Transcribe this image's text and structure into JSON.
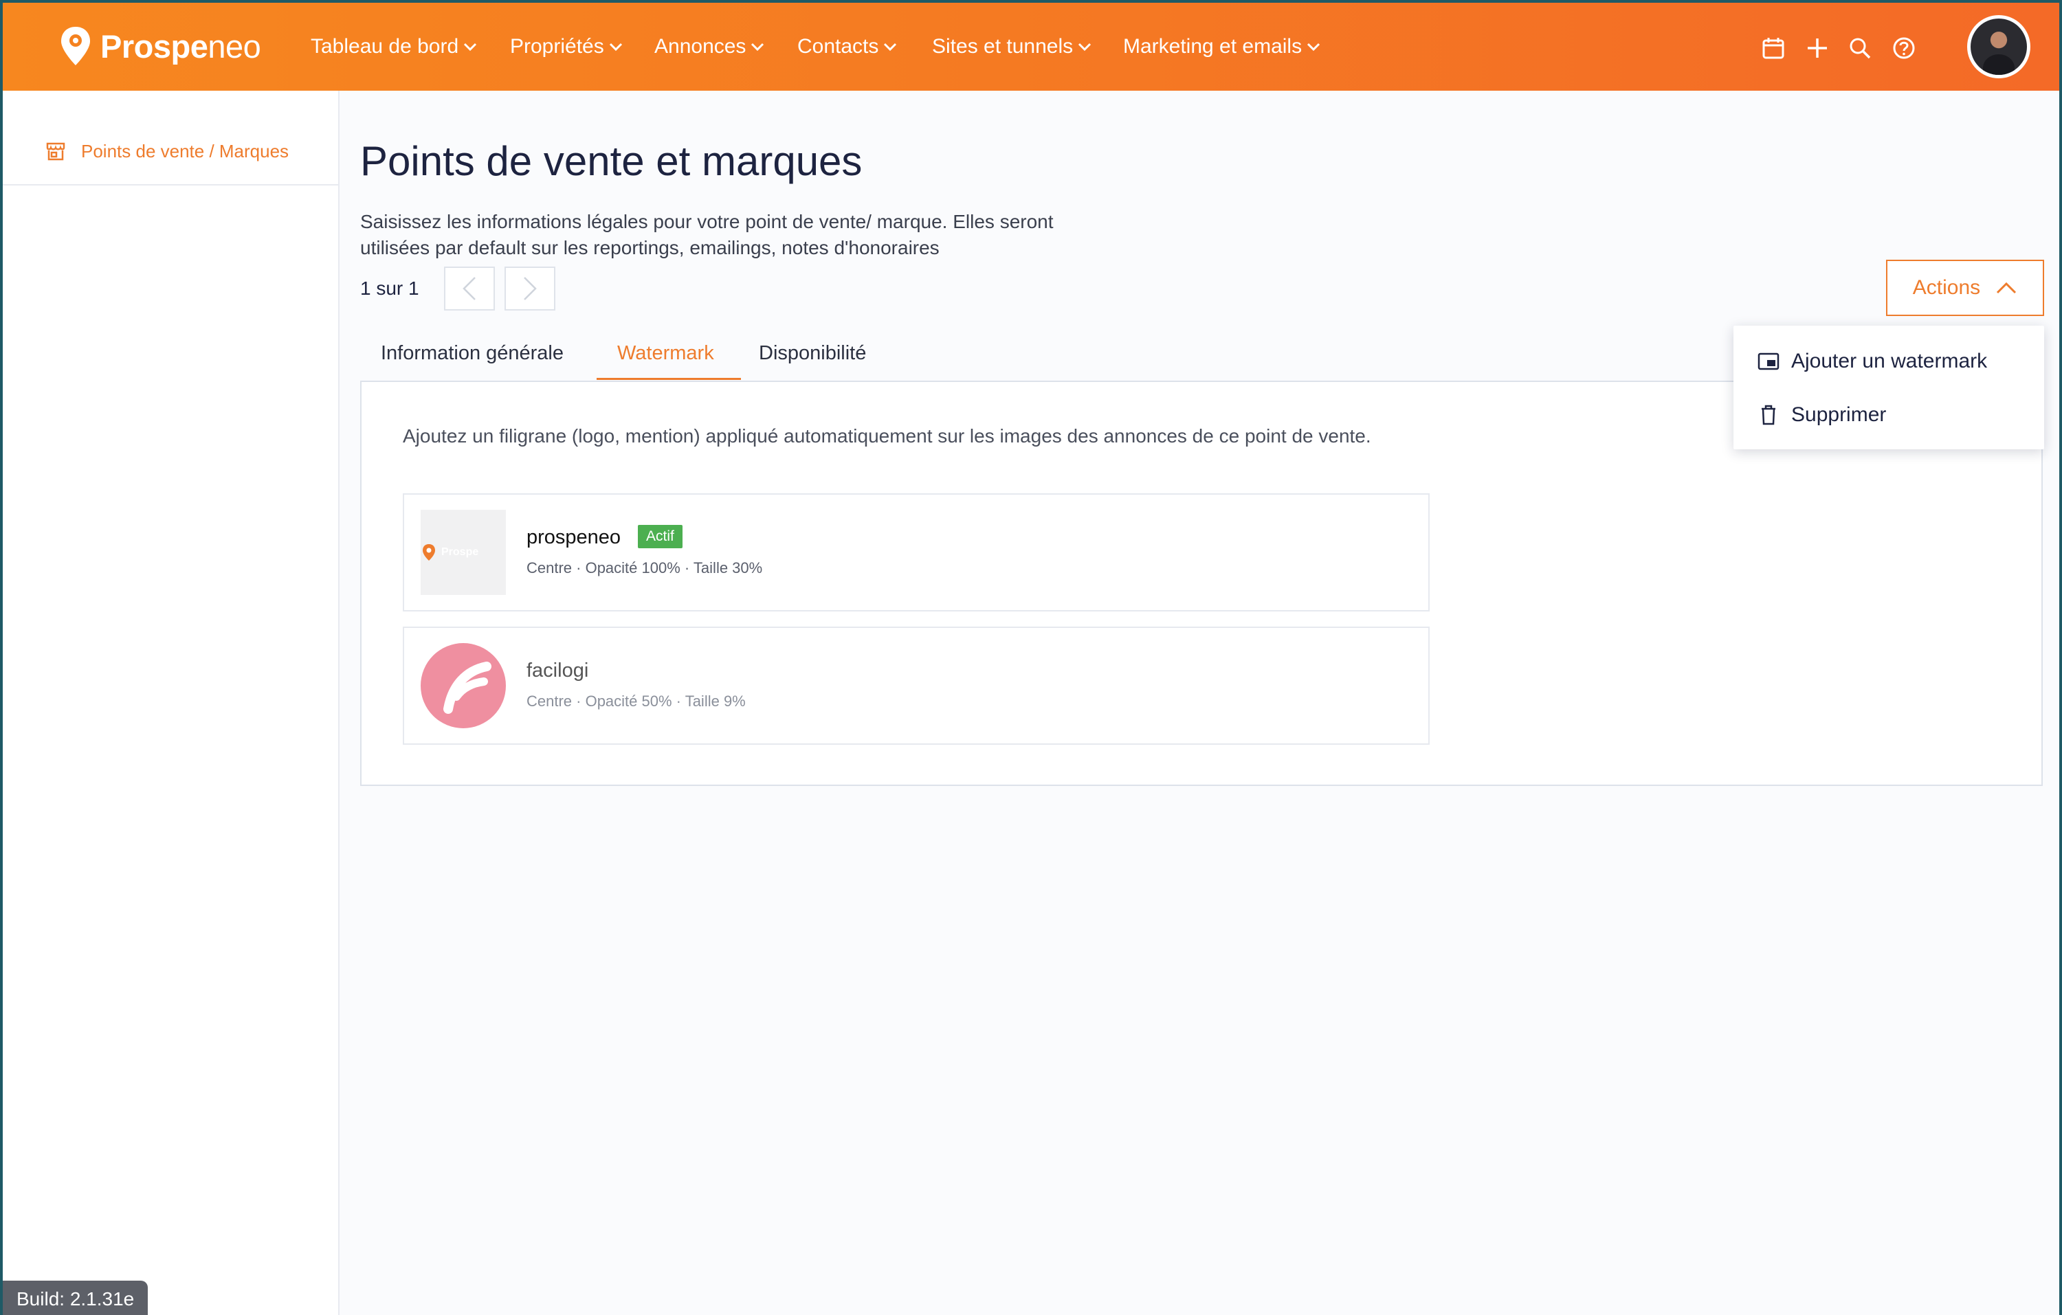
{
  "brand": {
    "name_bold": "Prospe",
    "name_rest": "neo"
  },
  "nav": [
    {
      "label": "Tableau de bord"
    },
    {
      "label": "Propriétés"
    },
    {
      "label": "Annonces"
    },
    {
      "label": "Contacts"
    },
    {
      "label": "Sites et tunnels"
    },
    {
      "label": "Marketing et emails"
    }
  ],
  "topbar_icons": [
    "calendar-icon",
    "plus-icon",
    "search-icon",
    "help-icon"
  ],
  "sidebar": {
    "items": [
      {
        "label": "Points de vente / Marques",
        "icon": "store-icon"
      }
    ]
  },
  "page": {
    "title": "Points de vente et marques",
    "description": "Saisissez les informations légales pour votre point de vente/ marque. Elles seront utilisées par default sur les reportings, emailings, notes d'honoraires",
    "pager": "1 sur 1",
    "actions_label": "Actions"
  },
  "tabs": [
    {
      "label": "Information générale"
    },
    {
      "label": "Watermark",
      "active": true
    },
    {
      "label": "Disponibilité"
    }
  ],
  "watermark": {
    "description": "Ajoutez un filigrane (logo, mention) appliqué automatiquement sur les images des annonces de ce point de vente.",
    "items": [
      {
        "name": "prospeneo",
        "badge": "Actif",
        "meta": "Centre · Opacité 100% · Taille 30%"
      },
      {
        "name": "facilogi",
        "meta": "Centre · Opacité 50% · Taille 9%"
      }
    ]
  },
  "actions_menu": [
    {
      "label": "Ajouter un watermark",
      "icon": "picture-in-picture-icon"
    },
    {
      "label": "Supprimer",
      "icon": "trash-icon"
    }
  ],
  "build": "Build: 2.1.31e",
  "colors": {
    "accent": "#ee7c2d",
    "topbar_start": "#f7871f",
    "topbar_end": "#f46a27",
    "badge": "#4caf50"
  }
}
